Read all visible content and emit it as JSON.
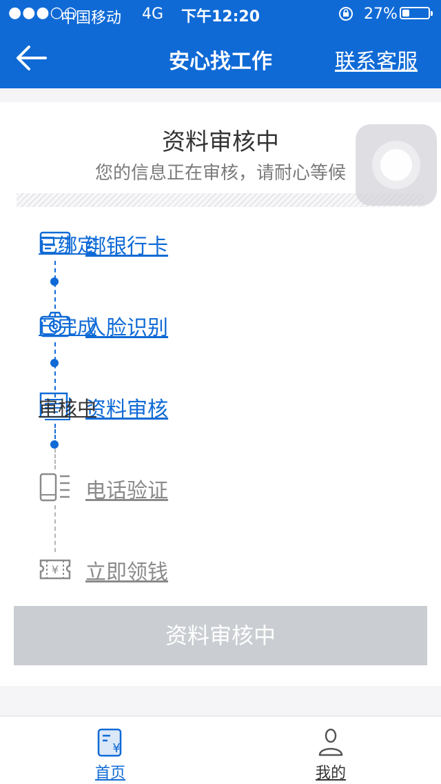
{
  "status_bar": {
    "signal": "●●●○○",
    "carrier": "中国移动",
    "network": "4G",
    "time": "下午12:20",
    "lock_icon": "rotation-lock-icon",
    "battery_text": "27%"
  },
  "nav": {
    "title": "安心找工作",
    "service_link": "联系客服"
  },
  "card": {
    "title": "资料审核中",
    "subtitle": "您的信息正在审核，请耐心等候"
  },
  "steps": [
    {
      "icon": "bank-card-icon",
      "label": "绑银行卡",
      "status": "已绑定"
    },
    {
      "icon": "camera-icon",
      "label": "人脸识别",
      "status": "已完成"
    },
    {
      "icon": "document-icon",
      "label": "资料审核",
      "status": "审核中"
    },
    {
      "icon": "phone-icon",
      "label": "电话验证",
      "status": ""
    },
    {
      "icon": "money-ticket-icon",
      "label": "立即领钱",
      "status": ""
    }
  ],
  "cta_label": "资料审核中",
  "tabs": [
    {
      "label": "首页",
      "icon": "home-yuan-icon",
      "active": true
    },
    {
      "label": "我的",
      "icon": "user-icon",
      "active": false
    }
  ],
  "colors": {
    "primary": "#0f6ad6",
    "disabled": "#cacdd1",
    "muted": "#8a8a8a"
  }
}
